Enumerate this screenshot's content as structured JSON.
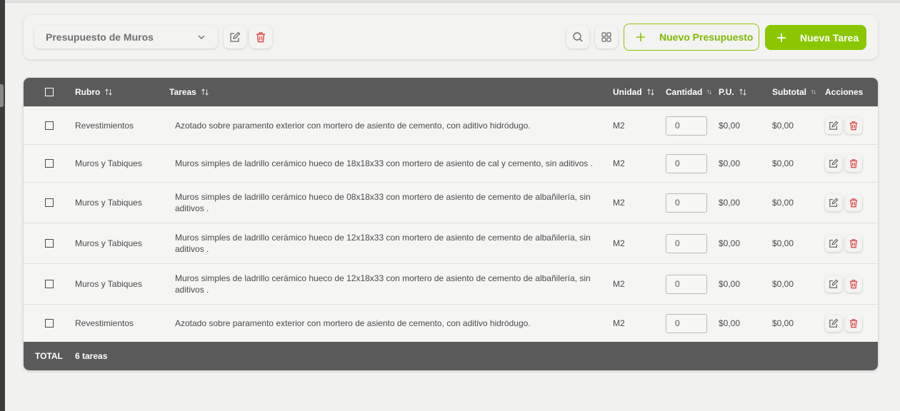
{
  "toolbar": {
    "budget_select": "Presupuesto de Muros",
    "new_budget_label": "Nuevo Presupuesto",
    "new_task_label": "Nueva Tarea"
  },
  "colors": {
    "accent": "#8ac700",
    "header_bg": "#5a5a5a",
    "delete": "#e04848"
  },
  "table": {
    "headers": {
      "rubro": "Rubro",
      "tareas": "Tareas",
      "unidad": "Unidad",
      "cantidad": "Cantidad",
      "pu": "P.U.",
      "subtotal": "Subtotal",
      "acciones": "Acciones"
    },
    "rows": [
      {
        "rubro": "Revestimientos",
        "tarea": "Azotado sobre paramento exterior con mortero de asiento de cemento, con aditivo hidródugo.",
        "unidad": "M2",
        "cantidad": "0",
        "pu": "$0,00",
        "subtotal": "$0,00"
      },
      {
        "rubro": "Muros y Tabiques",
        "tarea": "Muros simples de ladrillo cerámico hueco de 18x18x33 con mortero de asiento de cal y cemento, sin aditivos .",
        "unidad": "M2",
        "cantidad": "0",
        "pu": "$0,00",
        "subtotal": "$0,00"
      },
      {
        "rubro": "Muros y Tabiques",
        "tarea": "Muros simples de ladrillo cerámico hueco de 08x18x33 con mortero de asiento de cemento de albañilería, sin aditivos .",
        "unidad": "M2",
        "cantidad": "0",
        "pu": "$0,00",
        "subtotal": "$0,00"
      },
      {
        "rubro": "Muros y Tabiques",
        "tarea": "Muros simples de ladrillo cerámico hueco de 12x18x33 con mortero de asiento de cemento de albañilería, sin aditivos .",
        "unidad": "M2",
        "cantidad": "0",
        "pu": "$0,00",
        "subtotal": "$0,00"
      },
      {
        "rubro": "Muros y Tabiques",
        "tarea": "Muros simples de ladrillo cerámico hueco de 12x18x33 con mortero de asiento de cemento de albañilería, sin aditivos .",
        "unidad": "M2",
        "cantidad": "0",
        "pu": "$0,00",
        "subtotal": "$0,00"
      },
      {
        "rubro": "Revestimientos",
        "tarea": "Azotado sobre paramento exterior con mortero de asiento de cemento, con aditivo hidródugo.",
        "unidad": "M2",
        "cantidad": "0",
        "pu": "$0,00",
        "subtotal": "$0,00"
      }
    ],
    "footer": {
      "total_label": "TOTAL",
      "task_count": "6 tareas"
    }
  }
}
